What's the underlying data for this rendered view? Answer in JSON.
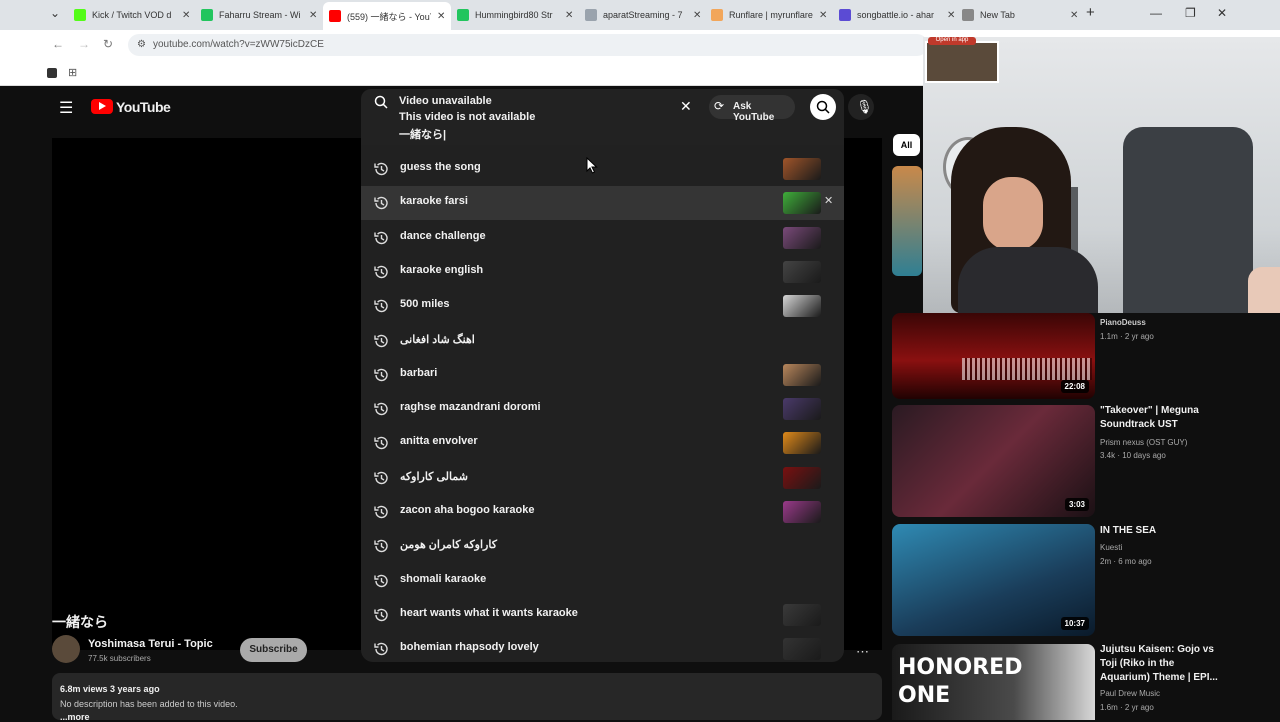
{
  "browser": {
    "tabs": [
      {
        "title": "Kick / Twitch VOD d",
        "color": "#53fc18"
      },
      {
        "title": "Faharru Stream - Wi",
        "color": "#22c55e"
      },
      {
        "title": "(559) 一緒なら - YouT",
        "color": "#ff0000"
      },
      {
        "title": "Hummingbird80 Str",
        "color": "#22c55e"
      },
      {
        "title": "aparatStreaming - 7",
        "color": "#9aa3ad"
      },
      {
        "title": "Runflare | myrunflare",
        "color": "#f2a65a"
      },
      {
        "title": "songbattle.io - ahar",
        "color": "#5b4bd4"
      },
      {
        "title": "New Tab",
        "color": "#888888"
      }
    ],
    "url": "youtube.com/watch?v=zWW75icDzCE",
    "open_in_app": "Open in app"
  },
  "yt": {
    "logo_text": "YouTube",
    "search": {
      "line1": "Video unavailable",
      "line2": "This video is not available",
      "query": "一緒なら|",
      "ask_label": "Ask YouTube"
    },
    "suggestions": [
      {
        "label": "guess the song",
        "thumb": "#a0552a"
      },
      {
        "label": "karaoke farsi",
        "thumb": "#3fae3a"
      },
      {
        "label": "dance challenge",
        "thumb": "#7a4a7a"
      },
      {
        "label": "karaoke english",
        "thumb": "#444444"
      },
      {
        "label": "500 miles",
        "thumb": "#d6d6d6"
      },
      {
        "label": "اهنگ شاد افغانی",
        "thumb": ""
      },
      {
        "label": "barbari",
        "thumb": "#b9875c"
      },
      {
        "label": "raghse mazandrani doromi",
        "thumb": "#4a3a6a"
      },
      {
        "label": "anitta envolver",
        "thumb": "#e08a1a"
      },
      {
        "label": "شمالی کاراوکه",
        "thumb": "#7a1010"
      },
      {
        "label": "zacon aha bogoo karaoke",
        "thumb": "#9a3a8a"
      },
      {
        "label": "کاراوکه کامران هومن",
        "thumb": ""
      },
      {
        "label": "shomali karaoke",
        "thumb": ""
      },
      {
        "label": "heart wants what it wants karaoke",
        "thumb": "#3a3a3a"
      },
      {
        "label": "bohemian rhapsody lovely",
        "thumb": "#333333"
      }
    ],
    "video": {
      "title": "一緒なら",
      "channel": "Yoshimasa Terui - Topic",
      "subs": "77.5k subscribers",
      "subscribe": "Subscribe",
      "views": "6.8m views  3 years ago",
      "desc": "No description has been added to this video.",
      "more": "...more"
    },
    "chip_all": "All",
    "recs": [
      {
        "title": "",
        "channel": "PianoDeuss",
        "meta": "1.1m · 2 yr ago",
        "dur": "22:08"
      },
      {
        "title": "\"Takeover\" | Meguna Soundtrack UST",
        "channel": "Prism nexus (OST GUY)",
        "meta": "3.4k · 10 days ago",
        "dur": "3:03"
      },
      {
        "title": "IN THE SEA",
        "channel": "Kuesti",
        "meta": "2m · 6 mo ago",
        "dur": "10:37"
      },
      {
        "title": "Jujutsu Kaisen: Gojo vs Toji (Riko in the Aquarium) Theme | EPI...",
        "channel": "Paul Drew Music",
        "meta": "1.6m · 2 yr ago",
        "dur": ""
      }
    ],
    "rec4_thumb_text": "HONORED ONE"
  }
}
